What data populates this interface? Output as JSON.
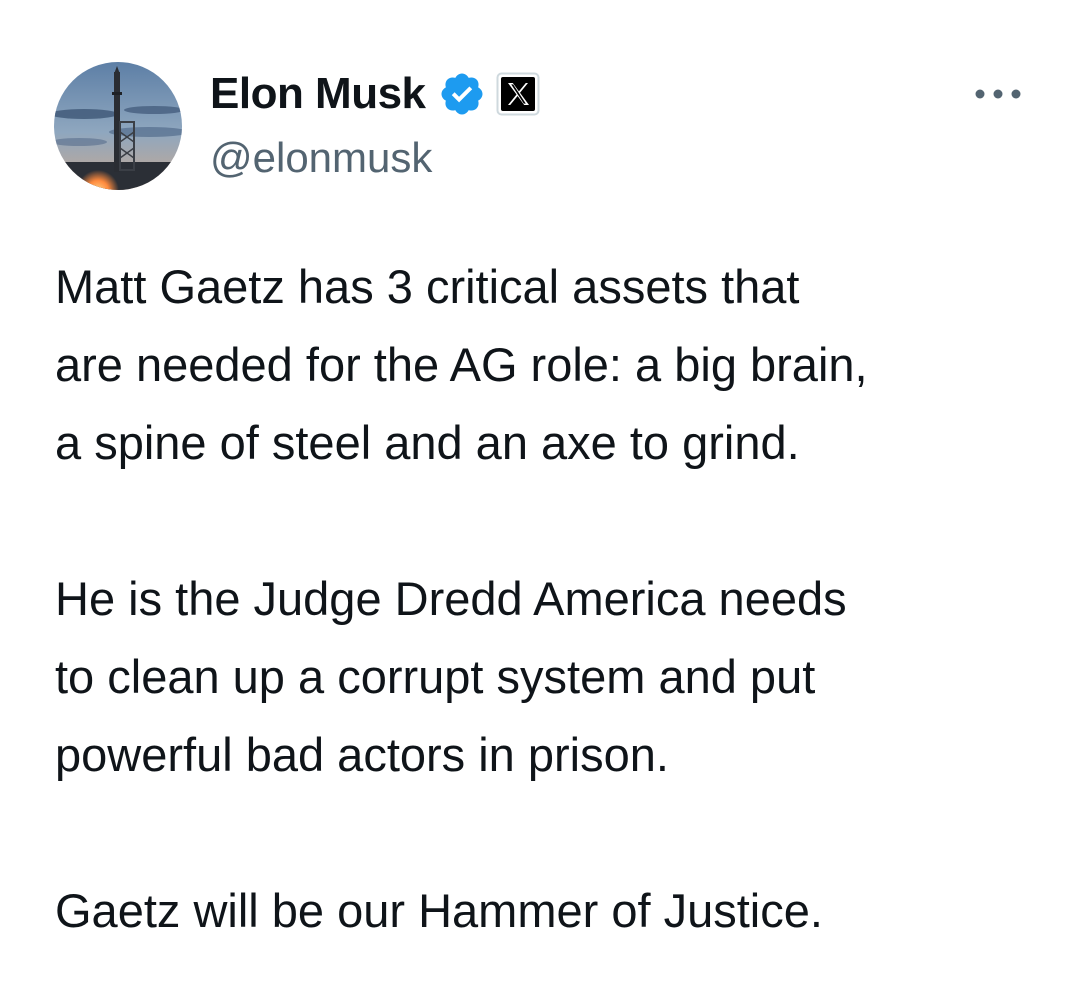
{
  "author": {
    "display_name": "Elon Musk",
    "handle": "@elonmusk",
    "verified": true,
    "affiliation_badge": "X"
  },
  "icons": {
    "verified": "verified-badge-icon",
    "affiliation": "x-logo-icon",
    "more": "more-horizontal-icon",
    "avatar": "rocket-launch-avatar"
  },
  "colors": {
    "text_primary": "#0f1419",
    "text_secondary": "#536471",
    "verified_blue": "#1d9bf0"
  },
  "tweet": {
    "paragraphs": [
      "Matt Gaetz has 3 critical assets that\nare needed for the AG role: a big brain,\na spine of steel and an axe to grind.",
      "He is the Judge Dredd America needs\nto clean up a corrupt system and put\npowerful bad actors in prison.",
      "Gaetz will be our Hammer of Justice."
    ]
  }
}
